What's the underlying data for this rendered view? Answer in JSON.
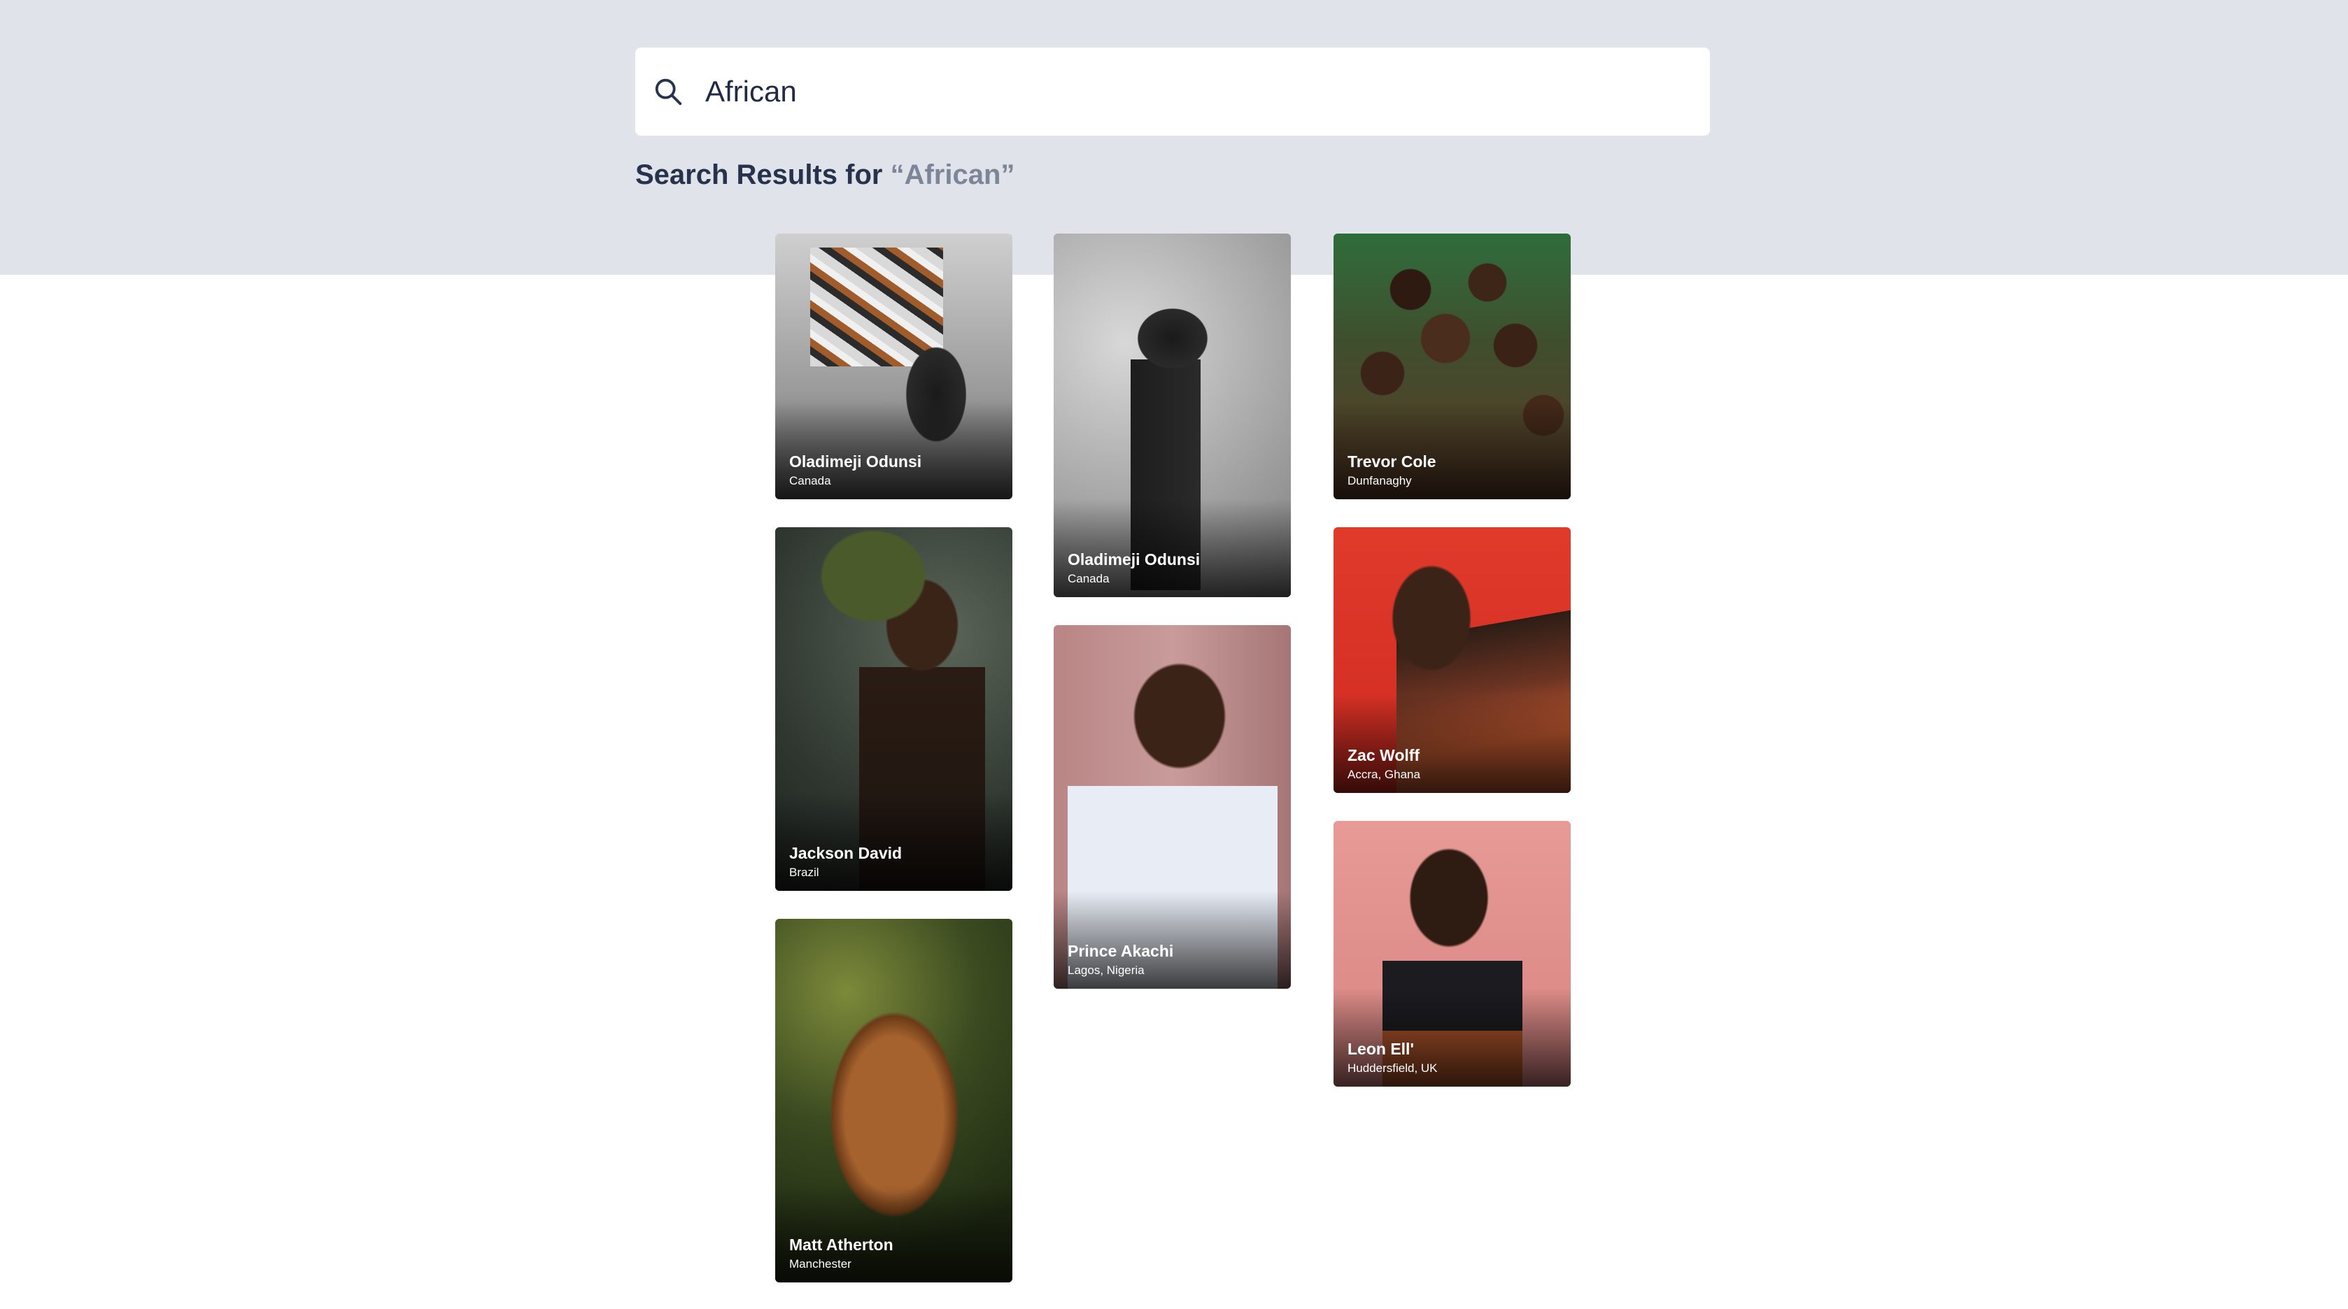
{
  "search": {
    "value": "African",
    "icon": "search-icon"
  },
  "results": {
    "heading_prefix": "Search Results for ",
    "heading_query": "“African”"
  },
  "cards": [
    {
      "name": "Oladimeji Odunsi",
      "location": "Canada"
    },
    {
      "name": "Jackson David",
      "location": "Brazil"
    },
    {
      "name": "Matt Atherton",
      "location": "Manchester"
    },
    {
      "name": "Oladimeji Odunsi",
      "location": "Canada"
    },
    {
      "name": "Prince Akachi",
      "location": "Lagos, Nigeria"
    },
    {
      "name": "Trevor Cole",
      "location": "Dunfanaghy"
    },
    {
      "name": "Zac Wolff",
      "location": "Accra, Ghana"
    },
    {
      "name": "Leon Ell'",
      "location": "Huddersfield, UK"
    }
  ],
  "colors": {
    "band": "#e0e3ea",
    "heading": "#27334d",
    "query": "#7d8699"
  }
}
